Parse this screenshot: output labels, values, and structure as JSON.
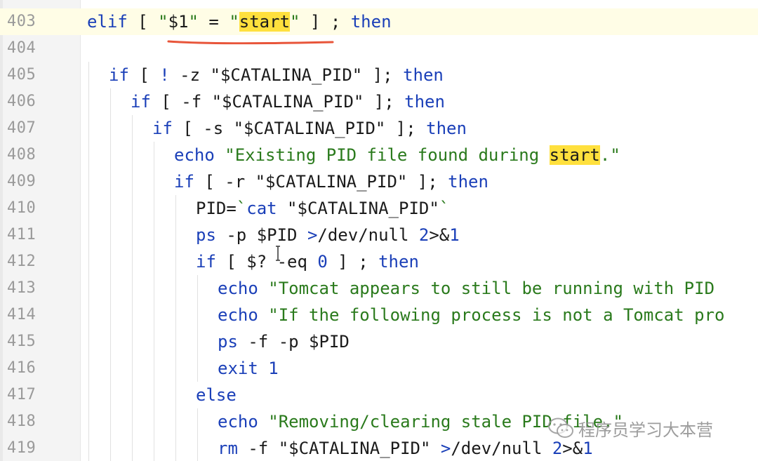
{
  "editor": {
    "language": "shell",
    "highlight_color": "#ffe03d",
    "keyword_color": "#1a3fb8",
    "string_color": "#2a7a1c",
    "current_line": 403,
    "partial_top_line": "402"
  },
  "lines": [
    {
      "number": "403",
      "text": "elif [ \"$1\" = \"start\" ] ; then"
    },
    {
      "number": "404",
      "text": ""
    },
    {
      "number": "405",
      "text": "if [ ! -z \"$CATALINA_PID\" ]; then"
    },
    {
      "number": "406",
      "text": "if [ -f \"$CATALINA_PID\" ]; then"
    },
    {
      "number": "407",
      "text": "if [ -s \"$CATALINA_PID\" ]; then"
    },
    {
      "number": "408",
      "text": "echo \"Existing PID file found during start.\""
    },
    {
      "number": "409",
      "text": "if [ -r \"$CATALINA_PID\" ]; then"
    },
    {
      "number": "410",
      "text": "PID=`cat \"$CATALINA_PID\"`"
    },
    {
      "number": "411",
      "text": "ps -p $PID >/dev/null 2>&1"
    },
    {
      "number": "412",
      "text": "if [ $? -eq 0 ] ; then"
    },
    {
      "number": "413",
      "text": "echo \"Tomcat appears to still be running with PID"
    },
    {
      "number": "414",
      "text": "echo \"If the following process is not a Tomcat pro"
    },
    {
      "number": "415",
      "text": "ps -f -p $PID"
    },
    {
      "number": "416",
      "text": "exit 1"
    },
    {
      "number": "417",
      "text": "else"
    },
    {
      "number": "418",
      "text": "echo \"Removing/clearing stale PID file.\""
    },
    {
      "number": "419",
      "text": "rm -f \"$CATALINA_PID\" >/dev/null 2>&1"
    }
  ],
  "annotation": {
    "underline_color": "#e8553a",
    "icon": "red-underline-mark"
  },
  "watermark": {
    "text": "程序员学习大本营",
    "icon": "wechat-icon"
  }
}
